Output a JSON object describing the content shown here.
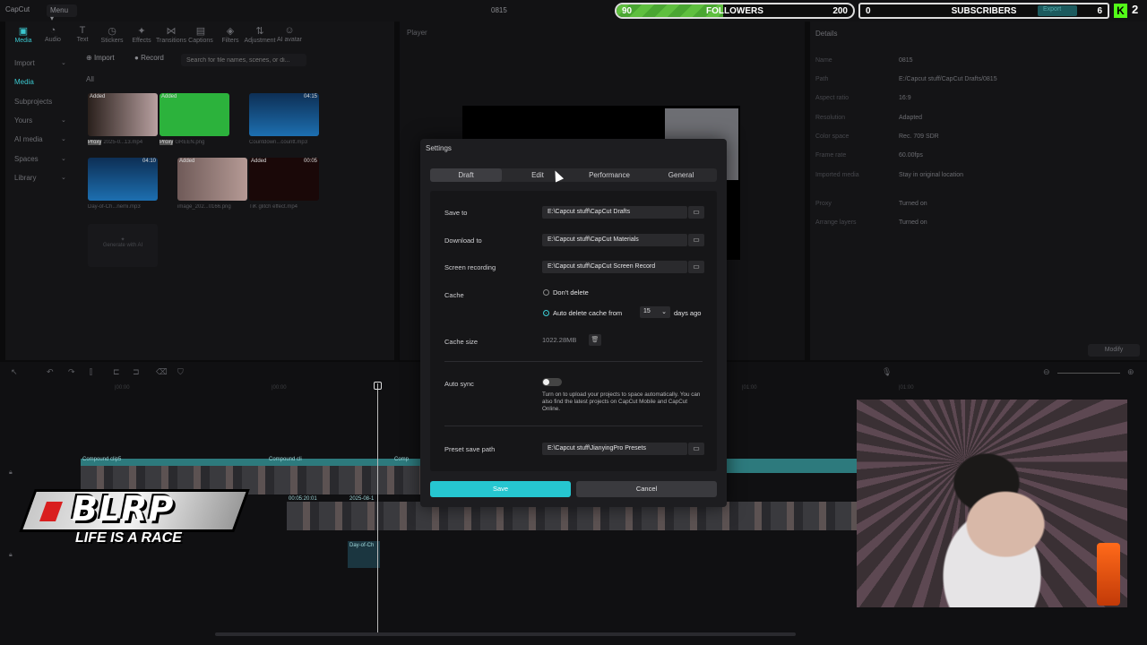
{
  "app": {
    "logo": "CapCut",
    "menu": "Menu ▾",
    "project": "0815"
  },
  "overlay": {
    "followers": {
      "current": "90",
      "label": "FOLLOWERS",
      "goal": "200",
      "progress": 0.45
    },
    "subscribers": {
      "current": "0",
      "label": "SUBSCRIBERS",
      "goal": "6"
    },
    "export_label": "Export",
    "kick_icon": "K",
    "kick_count": "2",
    "brand_name": "BLRP",
    "brand_slogan": "LIFE IS A RACE"
  },
  "toolbar": {
    "tools": [
      {
        "label": "Media",
        "icon": "▣"
      },
      {
        "label": "Audio",
        "icon": "◔"
      },
      {
        "label": "Text",
        "icon": "T"
      },
      {
        "label": "Stickers",
        "icon": "◷"
      },
      {
        "label": "Effects",
        "icon": "✦"
      },
      {
        "label": "Transitions",
        "icon": "⋈"
      },
      {
        "label": "Captions",
        "icon": "▤"
      },
      {
        "label": "Filters",
        "icon": "◈"
      },
      {
        "label": "Adjustment",
        "icon": "⇅"
      },
      {
        "label": "AI avatar",
        "icon": "☺"
      }
    ]
  },
  "sidebar": {
    "items": [
      {
        "label": "Import"
      },
      {
        "label": "Media"
      },
      {
        "label": "Subprojects"
      },
      {
        "label": "Yours"
      },
      {
        "label": "AI media"
      },
      {
        "label": "Spaces"
      },
      {
        "label": "Library"
      }
    ]
  },
  "media": {
    "import_label": "Import",
    "record_label": "Record",
    "search_placeholder": "Search for file names, scenes, or di...",
    "filter_all": "All",
    "items": [
      {
        "tag": "Added",
        "duration": "",
        "name": "2025-0...13.mp4",
        "badge": "Proxy"
      },
      {
        "tag": "Added",
        "duration": "",
        "name": "GREEN.png",
        "badge": "Proxy"
      },
      {
        "tag": "",
        "duration": "04:15",
        "name": "Countdown...countt.mp3",
        "badge": ""
      },
      {
        "tag": "",
        "duration": "04:10",
        "name": "Day-of-Ch...nemi.mp3",
        "badge": ""
      },
      {
        "tag": "Added",
        "duration": "",
        "name": "image_202...0166.png",
        "badge": ""
      },
      {
        "tag": "Added",
        "duration": "00:05",
        "name": "TiK glitch effect.mp4",
        "badge": ""
      }
    ],
    "generate_label": "Generate with AI"
  },
  "player": {
    "label": "Player"
  },
  "details": {
    "title": "Details",
    "rows": [
      {
        "label": "Name",
        "value": "0815"
      },
      {
        "label": "Path",
        "value": "E:/Capcut stuff/CapCut Drafts/0815"
      },
      {
        "label": "Aspect ratio",
        "value": "16:9"
      },
      {
        "label": "Resolution",
        "value": "Adapted"
      },
      {
        "label": "Color space",
        "value": "Rec. 709 SDR"
      },
      {
        "label": "Frame rate",
        "value": "60.00fps"
      },
      {
        "label": "Imported media",
        "value": "Stay in original location"
      },
      {
        "label": "Proxy",
        "value": "Turned on"
      },
      {
        "label": "Arrange layers",
        "value": "Turned on"
      }
    ],
    "modify_label": "Modify"
  },
  "timeline": {
    "ticks": [
      "|00:00",
      "|00:00",
      "|00:00",
      "|01:00",
      "|01:00",
      "|01:00"
    ],
    "clip_labels": [
      "Compound clip5",
      "Compound cli",
      "Comp",
      "00:05:20:01",
      "2025-08-1",
      "Day-of-Ch"
    ]
  },
  "settings": {
    "title": "Settings",
    "tabs": [
      "Draft",
      "Edit",
      "Performance",
      "General"
    ],
    "active_tab": "Draft",
    "save_to_label": "Save to",
    "save_to_path": "E:\\Capcut stuff\\CapCut Drafts",
    "download_to_label": "Download to",
    "download_to_path": "E:\\Capcut stuff\\CapCut Materials",
    "screen_recording_label": "Screen recording",
    "screen_recording_path": "E:\\Capcut stuff\\CapCut Screen Record",
    "cache_label": "Cache",
    "cache_opt_dont_delete": "Don't delete",
    "cache_opt_auto_delete": "Auto delete cache from",
    "cache_days": "15",
    "cache_days_suffix": "days ago",
    "cache_size_label": "Cache size",
    "cache_size_value": "1022.28MB",
    "auto_sync_label": "Auto sync",
    "auto_sync_desc": "Turn on to upload your projects to space automatically. You can also find the latest projects on CapCut Mobile and CapCut Online.",
    "preset_save_path_label": "Preset save path",
    "preset_save_path": "E:\\Capcut stuff\\JianyingPro Presets",
    "save_label": "Save",
    "cancel_label": "Cancel"
  },
  "colors": {
    "accent": "#26c6d0",
    "follower_bar": "#5fbf3f",
    "kick": "#53fc18"
  }
}
